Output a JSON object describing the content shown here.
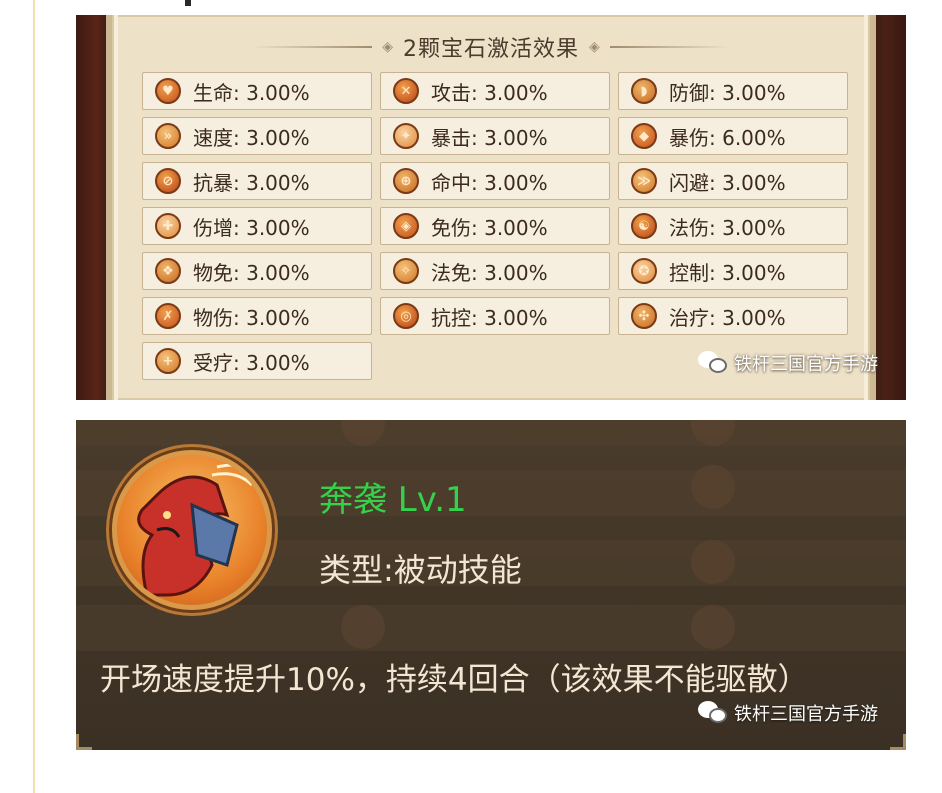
{
  "gem_panel": {
    "title": "2颗宝石激活效果",
    "effects": [
      {
        "label": "生命: 3.00%",
        "icon": "heart-icon",
        "glyph": "♥"
      },
      {
        "label": "攻击: 3.00%",
        "icon": "attack-icon",
        "glyph": "✕"
      },
      {
        "label": "防御: 3.00%",
        "icon": "defense-icon",
        "glyph": "◗"
      },
      {
        "label": "速度: 3.00%",
        "icon": "speed-icon",
        "glyph": "»"
      },
      {
        "label": "暴击: 3.00%",
        "icon": "crit-icon",
        "glyph": "✦"
      },
      {
        "label": "暴伤: 6.00%",
        "icon": "crit-damage-icon",
        "glyph": "◆"
      },
      {
        "label": "抗暴: 3.00%",
        "icon": "crit-resist-icon",
        "glyph": "⊘"
      },
      {
        "label": "命中: 3.00%",
        "icon": "accuracy-icon",
        "glyph": "⊕"
      },
      {
        "label": "闪避: 3.00%",
        "icon": "dodge-icon",
        "glyph": "≫"
      },
      {
        "label": "伤增: 3.00%",
        "icon": "damage-boost-icon",
        "glyph": "✚"
      },
      {
        "label": "免伤: 3.00%",
        "icon": "damage-reduction-icon",
        "glyph": "◈"
      },
      {
        "label": "法伤: 3.00%",
        "icon": "magic-damage-icon",
        "glyph": "☯"
      },
      {
        "label": "物免: 3.00%",
        "icon": "physical-immunity-icon",
        "glyph": "❖"
      },
      {
        "label": "法免: 3.00%",
        "icon": "magic-immunity-icon",
        "glyph": "✧"
      },
      {
        "label": "控制: 3.00%",
        "icon": "control-icon",
        "glyph": "✪"
      },
      {
        "label": "物伤: 3.00%",
        "icon": "physical-damage-icon",
        "glyph": "✗"
      },
      {
        "label": "抗控: 3.00%",
        "icon": "control-resist-icon",
        "glyph": "◎"
      },
      {
        "label": "治疗: 3.00%",
        "icon": "heal-icon",
        "glyph": "✣"
      },
      {
        "label": "受疗: 3.00%",
        "icon": "received-heal-icon",
        "glyph": "+"
      }
    ],
    "watermark": "铁杆三国官方手游"
  },
  "skill_panel": {
    "name": "奔袭 Lv.1",
    "type": "类型:被动技能",
    "description": "开场速度提升10%，持续4回合（该效果不能驱散）",
    "watermark": "铁杆三国官方手游",
    "name_color": "#36d14a"
  }
}
